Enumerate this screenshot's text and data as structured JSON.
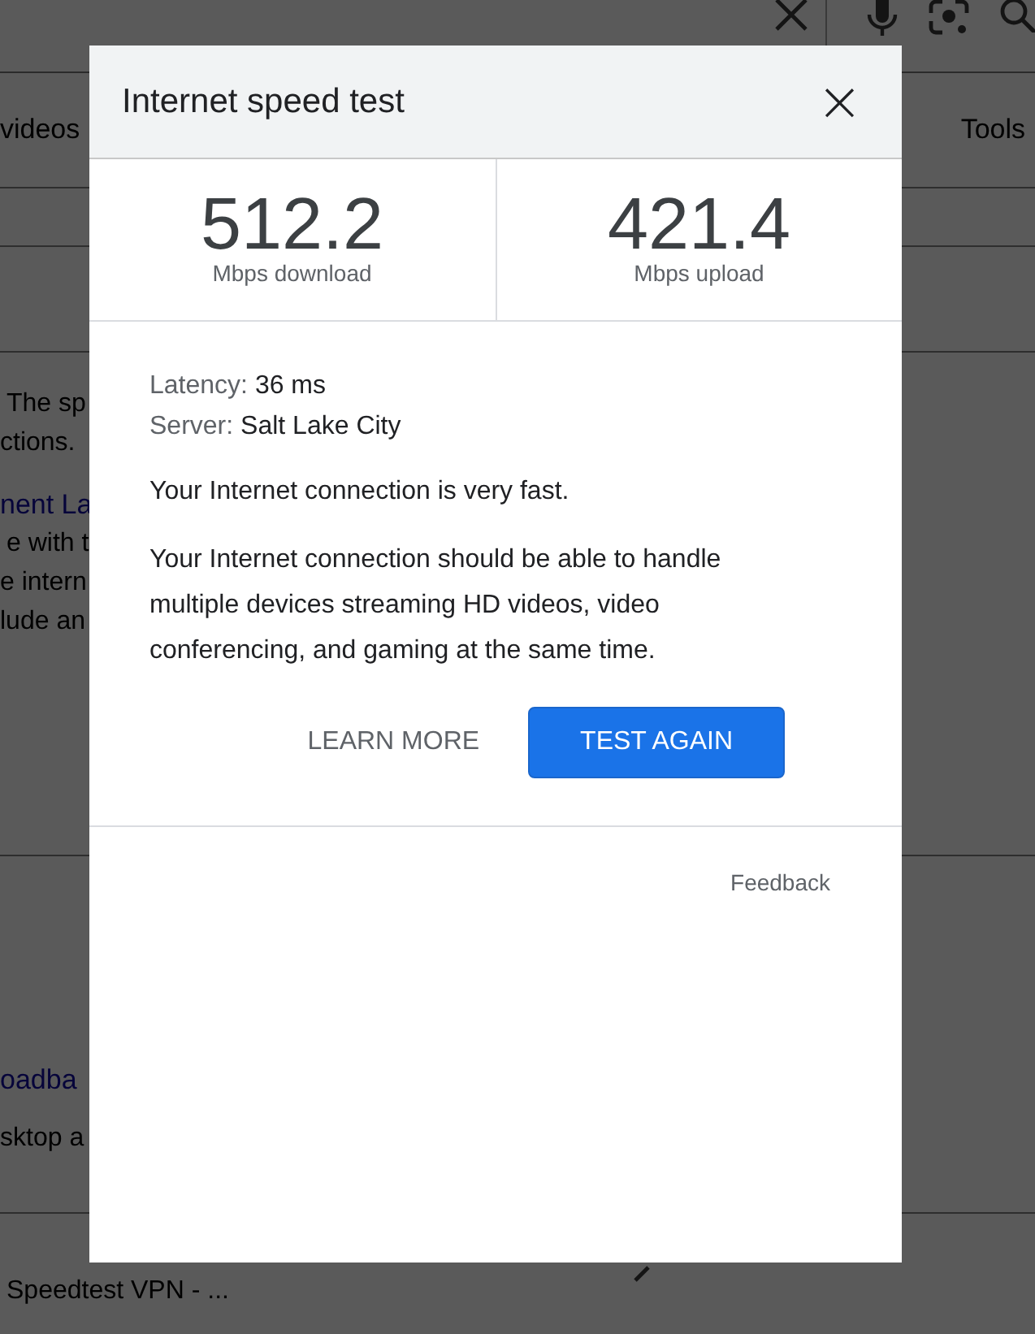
{
  "background": {
    "tab_left": "videos",
    "tab_right": "Tools",
    "result_1": [
      {
        "kind": "text",
        "text": "The sp"
      },
      {
        "kind": "text",
        "text": "ctions."
      }
    ],
    "result_2": [
      {
        "kind": "link",
        "text": "nent La"
      },
      {
        "kind": "text",
        "text": "e with t"
      },
      {
        "kind": "text",
        "text": "e intern"
      },
      {
        "kind": "text",
        "text": "lude an"
      }
    ],
    "result_3": [
      {
        "kind": "link",
        "text": "oadba"
      },
      {
        "kind": "text",
        "text": "sktop a"
      }
    ],
    "result_4": [
      {
        "kind": "text",
        "text": "Speedtest VPN - ..."
      }
    ]
  },
  "dialog": {
    "title": "Internet speed test",
    "close": "×",
    "stats": [
      {
        "value": "512.2",
        "label": "Mbps download"
      },
      {
        "value": "421.4",
        "label": "Mbps upload"
      }
    ],
    "details": [
      {
        "label": "Latency:",
        "value": "36 ms"
      },
      {
        "label": "Server:",
        "value": "Salt Lake City"
      }
    ],
    "verdict": "Your Internet connection is very fast.",
    "description": "Your Internet connection should be able to handle multiple devices streaming HD videos, video conferencing, and gaming at the same time.",
    "buttons": [
      {
        "label": "LEARN MORE",
        "kind": "text"
      },
      {
        "label": "TEST AGAIN",
        "kind": "primary"
      }
    ],
    "feedback": "Feedback"
  }
}
